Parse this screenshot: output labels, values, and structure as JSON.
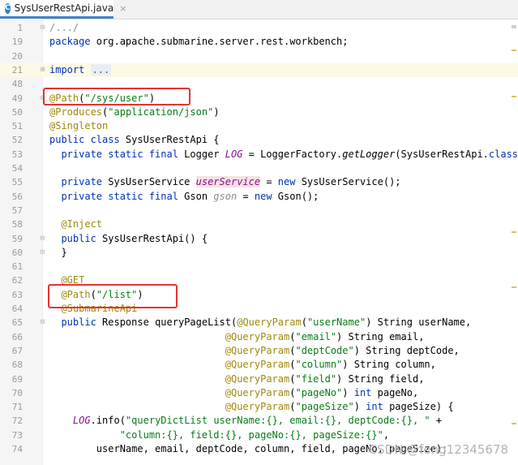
{
  "tab": {
    "label": "SysUserRestApi.java",
    "icon": "C",
    "close": "×"
  },
  "watermark": "CSDN @feng12345678",
  "lines": [
    {
      "num": "1",
      "fold": "⊟",
      "segs": [
        [
          "cmt",
          "/.../"
        ]
      ]
    },
    {
      "num": "19",
      "fold": "",
      "segs": [
        [
          "kw",
          "package "
        ],
        [
          "",
          "org.apache.submarine.server.rest.workbench;"
        ]
      ]
    },
    {
      "num": "20",
      "fold": "",
      "segs": []
    },
    {
      "num": "21",
      "fold": "⊞",
      "caret": true,
      "segs": [
        [
          "kw",
          "import "
        ],
        [
          "ellipsis",
          "..."
        ]
      ]
    },
    {
      "num": "48",
      "fold": "",
      "segs": []
    },
    {
      "num": "49",
      "fold": "⊟",
      "segs": [
        [
          "ann",
          "@Path"
        ],
        [
          "",
          "("
        ],
        [
          "str",
          "\"/sys/user\""
        ],
        [
          "",
          ")"
        ]
      ]
    },
    {
      "num": "50",
      "fold": "",
      "segs": [
        [
          "ann",
          "@Produces"
        ],
        [
          "",
          "("
        ],
        [
          "str",
          "\"application/json\""
        ],
        [
          "",
          ")"
        ]
      ]
    },
    {
      "num": "51",
      "fold": "",
      "segs": [
        [
          "ann",
          "@Singleton"
        ]
      ]
    },
    {
      "num": "52",
      "fold": "",
      "segs": [
        [
          "kw",
          "public class "
        ],
        [
          "",
          "SysUserRestApi {"
        ]
      ]
    },
    {
      "num": "53",
      "fold": "",
      "segs": [
        [
          "",
          "  "
        ],
        [
          "kw",
          "private static final "
        ],
        [
          "",
          "Logger "
        ],
        [
          "sfld",
          "LOG"
        ],
        [
          "",
          " = LoggerFactory."
        ],
        [
          "ital",
          "getLogger"
        ],
        [
          "",
          "(SysUserRestApi."
        ],
        [
          "kw",
          "class"
        ],
        [
          "",
          ");"
        ]
      ]
    },
    {
      "num": "54",
      "fold": "",
      "segs": []
    },
    {
      "num": "55",
      "fold": "",
      "segs": [
        [
          "",
          "  "
        ],
        [
          "kw",
          "private "
        ],
        [
          "",
          "SysUserService "
        ],
        [
          "hlfld",
          "userService"
        ],
        [
          "",
          " = "
        ],
        [
          "kw",
          "new "
        ],
        [
          "",
          "SysUserService();"
        ]
      ]
    },
    {
      "num": "56",
      "fold": "",
      "segs": [
        [
          "",
          "  "
        ],
        [
          "kw",
          "private static final "
        ],
        [
          "",
          "Gson "
        ],
        [
          "grey",
          "gson"
        ],
        [
          "",
          " = "
        ],
        [
          "kw",
          "new "
        ],
        [
          "",
          "Gson();"
        ]
      ]
    },
    {
      "num": "57",
      "fold": "",
      "segs": []
    },
    {
      "num": "58",
      "fold": "",
      "segs": [
        [
          "",
          "  "
        ],
        [
          "ann",
          "@Inject"
        ]
      ]
    },
    {
      "num": "59",
      "fold": "⊟",
      "segs": [
        [
          "",
          "  "
        ],
        [
          "kw",
          "public "
        ],
        [
          "",
          "SysUserRestApi() {"
        ]
      ]
    },
    {
      "num": "60",
      "fold": "⊡",
      "segs": [
        [
          "",
          "  }"
        ]
      ]
    },
    {
      "num": "61",
      "fold": "",
      "segs": []
    },
    {
      "num": "62",
      "fold": "",
      "segs": [
        [
          "",
          "  "
        ],
        [
          "ann",
          "@GET"
        ]
      ]
    },
    {
      "num": "63",
      "fold": "",
      "segs": [
        [
          "",
          "  "
        ],
        [
          "ann",
          "@Path"
        ],
        [
          "",
          "("
        ],
        [
          "str",
          "\"/list\""
        ],
        [
          "",
          ")"
        ]
      ]
    },
    {
      "num": "64",
      "fold": "",
      "segs": [
        [
          "",
          "  "
        ],
        [
          "ann",
          "@SubmarineApi"
        ]
      ]
    },
    {
      "num": "65",
      "fold": "⊟",
      "segs": [
        [
          "",
          "  "
        ],
        [
          "kw",
          "public "
        ],
        [
          "",
          "Response "
        ],
        [
          "",
          "queryPageList("
        ],
        [
          "ann",
          "@QueryParam"
        ],
        [
          "",
          "("
        ],
        [
          "str",
          "\"userName\""
        ],
        [
          "",
          ") String userName,"
        ]
      ]
    },
    {
      "num": "66",
      "fold": "",
      "segs": [
        [
          "",
          "                              "
        ],
        [
          "ann",
          "@QueryParam"
        ],
        [
          "",
          "("
        ],
        [
          "str",
          "\"email\""
        ],
        [
          "",
          ") String email,"
        ]
      ]
    },
    {
      "num": "67",
      "fold": "",
      "segs": [
        [
          "",
          "                              "
        ],
        [
          "ann",
          "@QueryParam"
        ],
        [
          "",
          "("
        ],
        [
          "str",
          "\"deptCode\""
        ],
        [
          "",
          ") String deptCode,"
        ]
      ]
    },
    {
      "num": "68",
      "fold": "",
      "segs": [
        [
          "",
          "                              "
        ],
        [
          "ann",
          "@QueryParam"
        ],
        [
          "",
          "("
        ],
        [
          "str",
          "\"column\""
        ],
        [
          "",
          ") String column,"
        ]
      ]
    },
    {
      "num": "69",
      "fold": "",
      "segs": [
        [
          "",
          "                              "
        ],
        [
          "ann",
          "@QueryParam"
        ],
        [
          "",
          "("
        ],
        [
          "str",
          "\"field\""
        ],
        [
          "",
          ") String field,"
        ]
      ]
    },
    {
      "num": "70",
      "fold": "",
      "segs": [
        [
          "",
          "                              "
        ],
        [
          "ann",
          "@QueryParam"
        ],
        [
          "",
          "("
        ],
        [
          "str",
          "\"pageNo\""
        ],
        [
          "",
          ") "
        ],
        [
          "kw",
          "int "
        ],
        [
          "",
          "pageNo,"
        ]
      ]
    },
    {
      "num": "71",
      "fold": "",
      "segs": [
        [
          "",
          "                              "
        ],
        [
          "ann",
          "@QueryParam"
        ],
        [
          "",
          "("
        ],
        [
          "str",
          "\"pageSize\""
        ],
        [
          "",
          ") "
        ],
        [
          "kw",
          "int "
        ],
        [
          "",
          "pageSize) {"
        ]
      ]
    },
    {
      "num": "72",
      "fold": "",
      "segs": [
        [
          "",
          "    "
        ],
        [
          "sfld",
          "LOG"
        ],
        [
          "",
          ".info("
        ],
        [
          "str",
          "\"queryDictList userName:{}, email:{}, deptCode:{}, \""
        ],
        [
          "",
          " +"
        ]
      ]
    },
    {
      "num": "73",
      "fold": "",
      "segs": [
        [
          "",
          "            "
        ],
        [
          "str",
          "\"column:{}, field:{}, pageNo:{}, pageSize:{}\""
        ],
        [
          "",
          ","
        ]
      ]
    },
    {
      "num": "74",
      "fold": "",
      "segs": [
        [
          "",
          "        userName, email, deptCode, column, field, pageNo, pageSize);"
        ]
      ]
    }
  ]
}
